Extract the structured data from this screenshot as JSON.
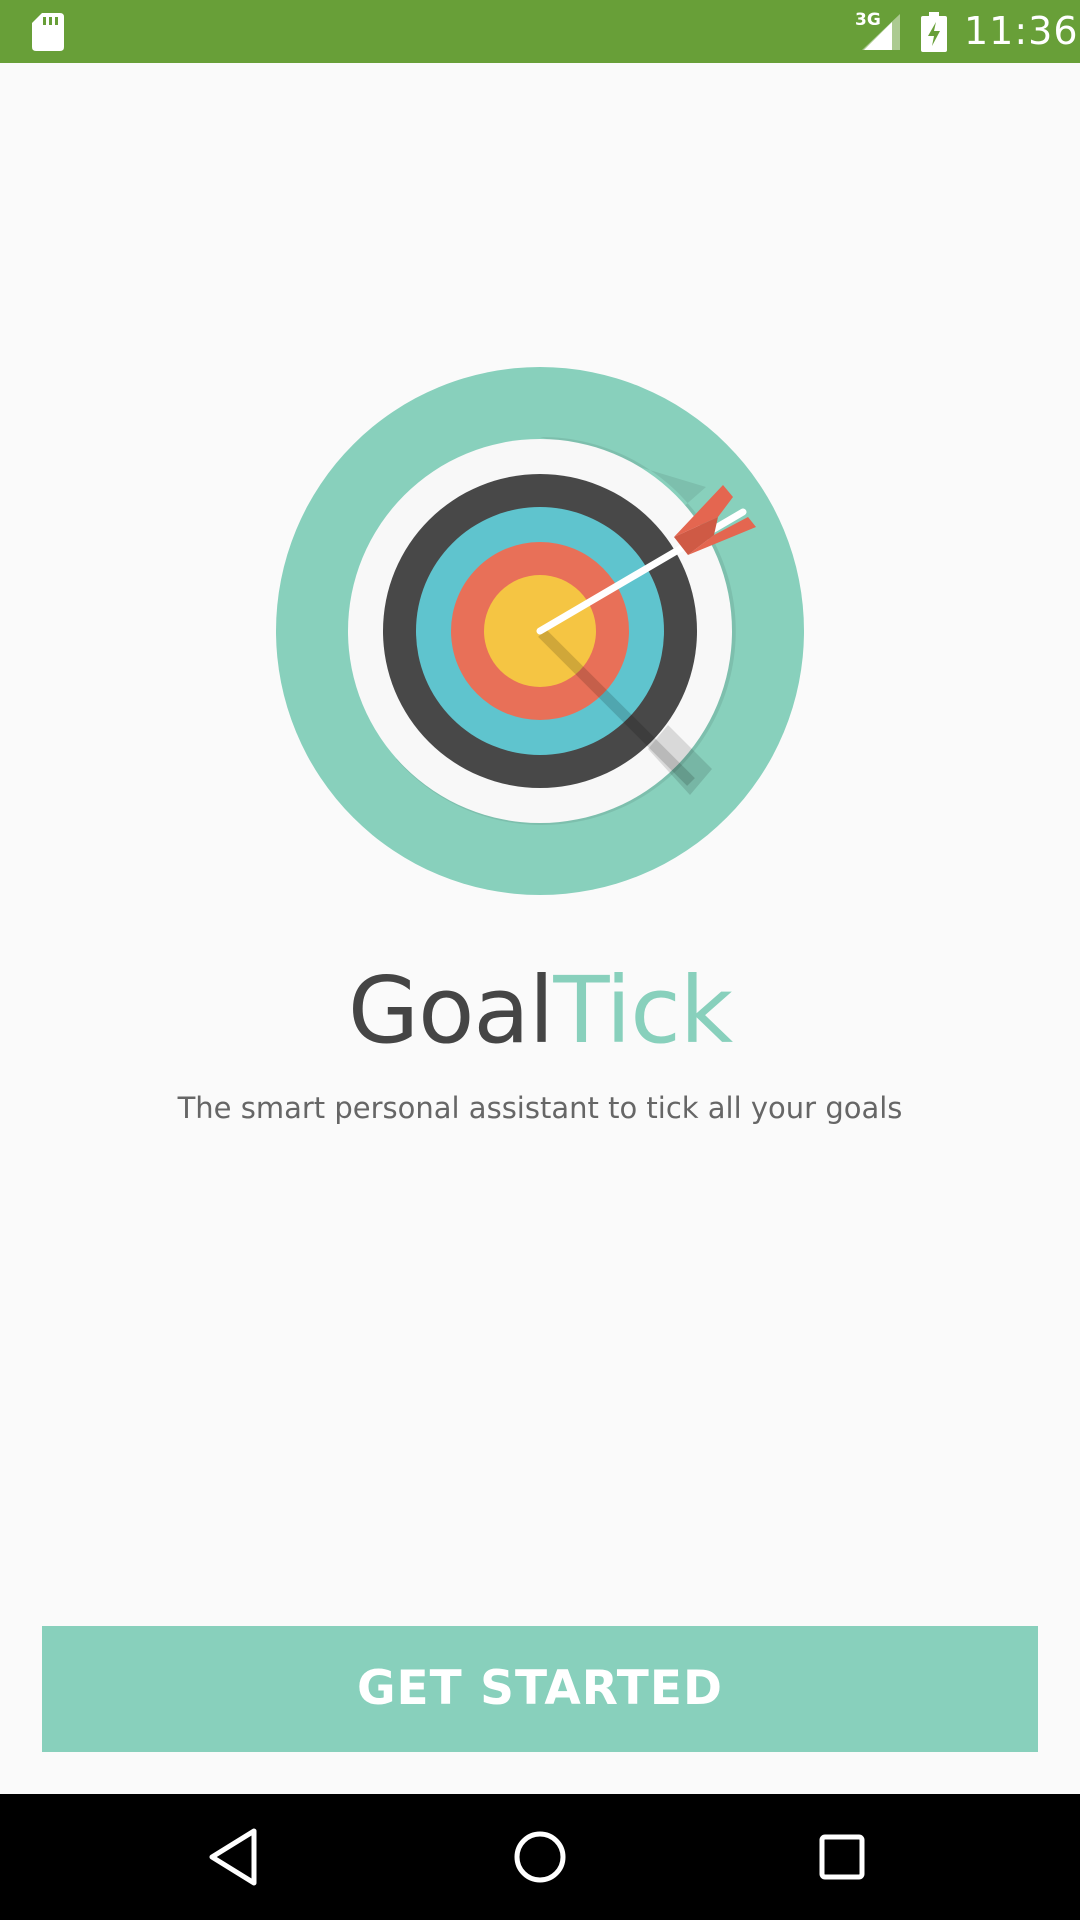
{
  "status_bar": {
    "network_type": "3G",
    "time": "11:36",
    "background_color": "#689f38",
    "icons": [
      "sd-card-icon",
      "signal-icon",
      "battery-charging-icon"
    ]
  },
  "app": {
    "title_part1": "Goal",
    "title_part2": "Tick",
    "tagline": "The smart personal assistant to tick all your goals",
    "logo_icon": "target-arrow-icon",
    "colors": {
      "title_dark": "#454545",
      "accent": "#88d0bc"
    }
  },
  "actions": {
    "get_started_label": "GET STARTED"
  },
  "nav_bar": {
    "icons": [
      "back-icon",
      "home-icon",
      "recents-icon"
    ]
  }
}
